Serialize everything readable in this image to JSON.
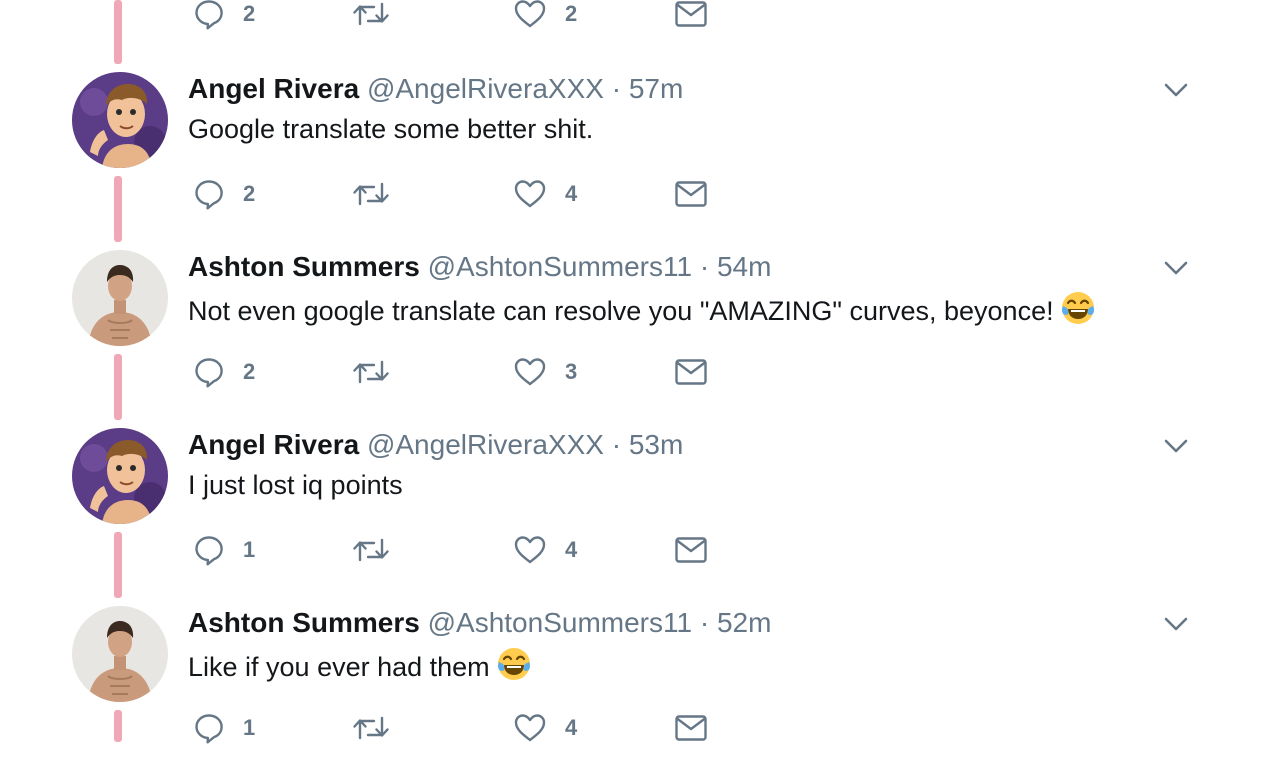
{
  "top_actions": {
    "replies": "2",
    "likes": "2"
  },
  "tweets": [
    {
      "avatar_icon": "cartoon-avatar-icon",
      "name": "Angel Rivera",
      "handle": "@AngelRiveraXXX",
      "dot": "·",
      "time": "57m",
      "text": "Google translate some better shit.",
      "emoji": "",
      "replies": "2",
      "likes": "4"
    },
    {
      "avatar_icon": "photo-avatar-icon",
      "name": "Ashton Summers",
      "handle": "@AshtonSummers11",
      "dot": "·",
      "time": "54m",
      "text": "Not even google translate can resolve you \"AMAZING\" curves, beyonce!",
      "emoji": "face-with-tears-of-joy",
      "replies": "2",
      "likes": "3"
    },
    {
      "avatar_icon": "cartoon-avatar-icon",
      "name": "Angel Rivera",
      "handle": "@AngelRiveraXXX",
      "dot": "·",
      "time": "53m",
      "text": "I just lost iq points",
      "emoji": "",
      "replies": "1",
      "likes": "4"
    },
    {
      "avatar_icon": "photo-avatar-icon",
      "name": "Ashton Summers",
      "handle": "@AshtonSummers11",
      "dot": "·",
      "time": "52m",
      "text": "Like if you ever had them",
      "emoji": "face-with-tears-of-joy",
      "replies": "1",
      "likes": "4"
    }
  ],
  "colors": {
    "thread_line": "#f0a8b6",
    "secondary_text": "#657786",
    "primary_text": "#14171a"
  }
}
